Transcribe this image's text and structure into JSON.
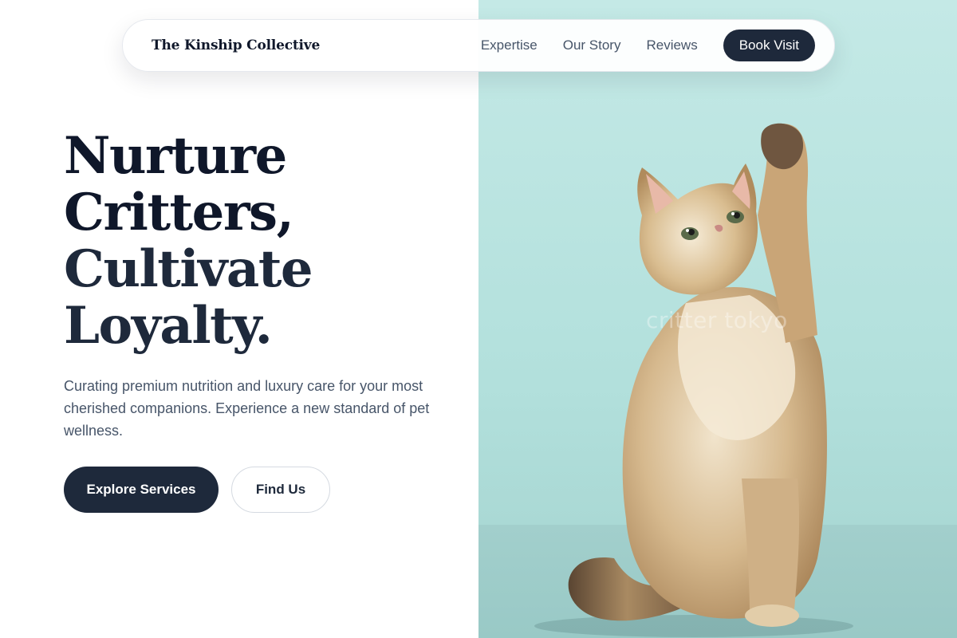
{
  "nav": {
    "brand": "The Kinship Collective",
    "links": [
      "Expertise",
      "Our Story",
      "Reviews"
    ],
    "cta": "Book Visit"
  },
  "hero": {
    "title_lines": [
      "Nurture",
      "Critters,",
      "Cultivate",
      "Loyalty."
    ],
    "subtitle": "Curating premium nutrition and luxury care for your most cherished companions. Experience a new standard of pet wellness.",
    "primary_button": "Explore Services",
    "secondary_button": "Find Us"
  },
  "image": {
    "subject": "kitten-raising-paw",
    "watermark": "critter tokyo"
  },
  "colors": {
    "primary": "#1e293b",
    "panel_bg": "#b8e4e0",
    "text_muted": "#475569"
  }
}
